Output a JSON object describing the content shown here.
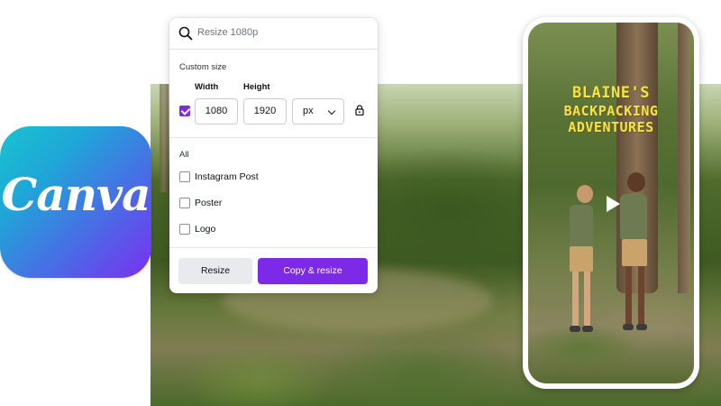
{
  "search": {
    "placeholder": "Resize 1080p"
  },
  "custom_size": {
    "heading": "Custom size",
    "width_label": "Width",
    "height_label": "Height",
    "width_value": "1080",
    "height_value": "1920",
    "unit": "px",
    "checked": true
  },
  "all_section": {
    "heading": "All",
    "options": [
      {
        "label": "Instagram Post",
        "checked": false
      },
      {
        "label": "Poster",
        "checked": false
      },
      {
        "label": "Logo",
        "checked": false
      }
    ]
  },
  "buttons": {
    "resize": "Resize",
    "copy_resize": "Copy & resize"
  },
  "brand": {
    "name": "Canva"
  },
  "story": {
    "title_line1": "BLAINE'S",
    "title_line2": "BACKPACKING",
    "title_line3": "ADVENTURES"
  },
  "colors": {
    "accent": "#7d2ae8",
    "title_yellow": "#f2e34a"
  },
  "icons": {
    "search": "search-icon",
    "lock": "lock-icon",
    "chevron": "chevron-down-icon",
    "play": "play-icon"
  }
}
